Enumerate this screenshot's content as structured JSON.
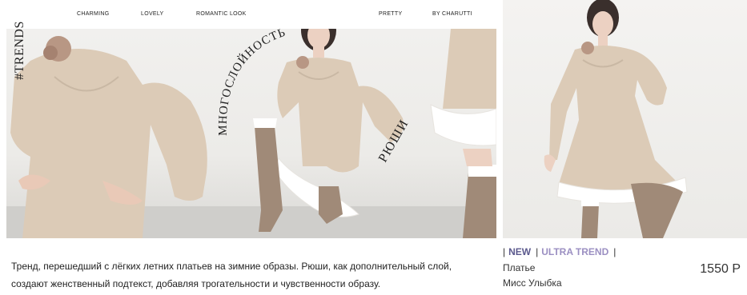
{
  "nav": {
    "items": [
      "CHARMING",
      "LOVELY",
      "ROMANTIC LOOK",
      "PRETTY",
      "BY CHARUTTI"
    ]
  },
  "banner": {
    "hashtag": "#TRENDS",
    "arc_word": "МНОГОСЛОЙНОСТЬ",
    "ruffle_word": "РЮШИ"
  },
  "description": "Тренд, перешедший с лёгких летних платьев на зимние образы. Рюши, как дополнительный слой, создают женственный подтекст, добавляя трогательности и чувственности образу.",
  "product": {
    "tag_new": "NEW",
    "tag_ultra": "ULTRA TREND",
    "type": "Платье",
    "name": "Мисс Улыбка",
    "price": "1550 Р"
  },
  "colors": {
    "dress": "#dccbb7",
    "ruffle": "#ffffff",
    "boots": "#a08a78",
    "tag_new": "#5c5a8e",
    "tag_ultra": "#9b8fc2"
  }
}
